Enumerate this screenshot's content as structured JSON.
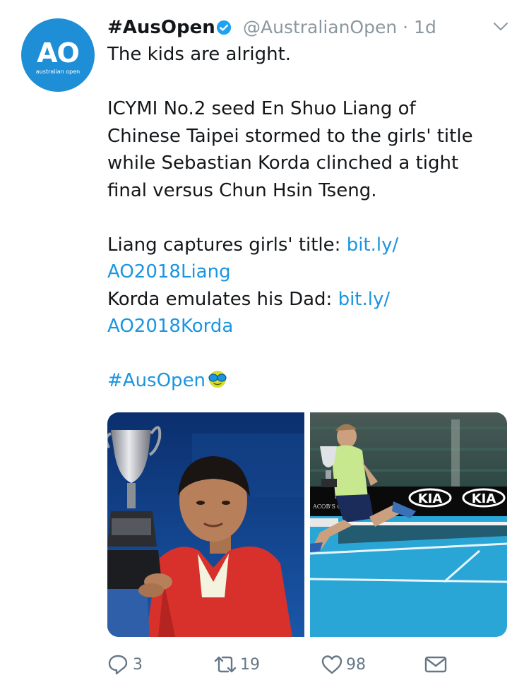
{
  "account": {
    "display_name": "#AusOpen",
    "handle": "@AustralianOpen",
    "time": "· 1d",
    "avatar_text": "AO",
    "avatar_subtext": "australian open",
    "avatar_color": "#1e8fd6"
  },
  "tweet": {
    "lines": [
      "The kids are alright.",
      "ICYMI No.2 seed En Shuo Liang of",
      "Chinese Taipei stormed to the girls' title",
      "while Sebastian Korda clinched a tight",
      "final versus Chun Hsin Tseng.",
      "Liang captures girls' title: ",
      "bit.ly/",
      "AO2018Liang",
      "Korda emulates his Dad: ",
      "bit.ly/",
      "AO2018Korda",
      "#AusOpen"
    ],
    "hashtag_emoji": "tennis-ball-with-sunglasses"
  },
  "media": {
    "photos": [
      {
        "label": "girls-champion-with-trophy"
      },
      {
        "label": "boys-champion-jumping-with-trophy",
        "signage": [
          "KIA",
          "KIA",
          "ACOB'S CREEK"
        ]
      }
    ]
  },
  "actions": {
    "reply_count": "3",
    "retweet_count": "19",
    "like_count": "98"
  },
  "colors": {
    "link": "#1b95e0",
    "muted": "#8b979f",
    "text": "#14171a",
    "verified": "#1da1f2",
    "court": "#2aa6d6"
  }
}
